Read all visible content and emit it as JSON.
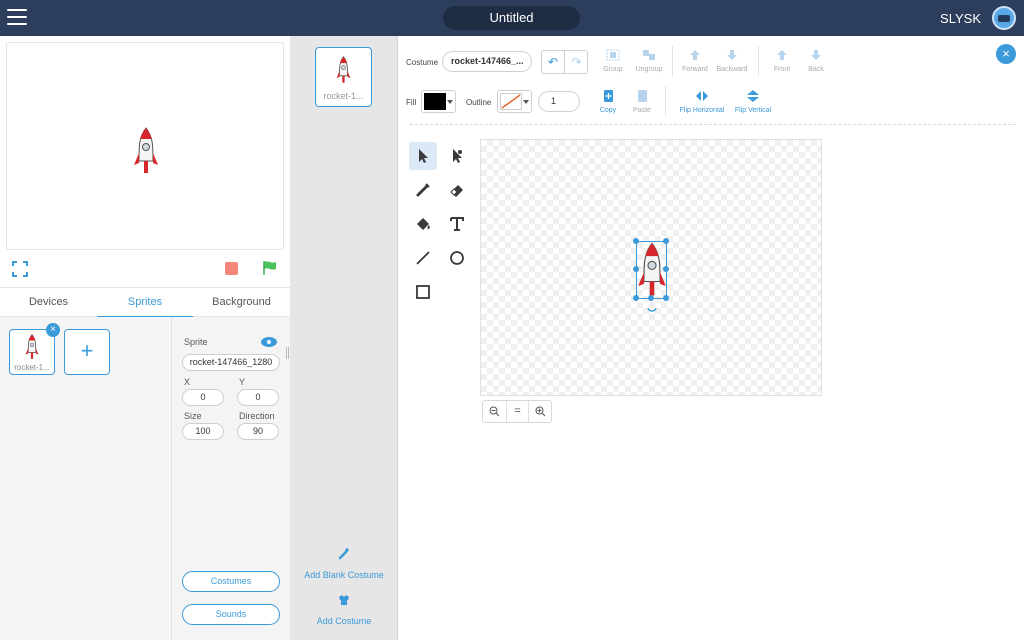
{
  "app": {
    "project_title": "Untitled",
    "user_name": "SLYSK",
    "icons": {
      "menu": "hamburger-menu-icon",
      "robot": "robot-icon"
    }
  },
  "stage": {
    "controls": {
      "fullscreen": "fullscreen-icon",
      "stop": "stop-icon",
      "go": "green-flag-icon"
    }
  },
  "tabs": [
    {
      "label": "Devices",
      "active": false
    },
    {
      "label": "Sprites",
      "active": true
    },
    {
      "label": "Background",
      "active": false
    }
  ],
  "sprites": {
    "items": [
      {
        "label": "rocket-1..."
      }
    ],
    "add_label": "+"
  },
  "sprite_props": {
    "sprite_label": "Sprite",
    "sprite_name": "rocket-147466_1280",
    "x_label": "X",
    "x_value": "0",
    "y_label": "Y",
    "y_value": "0",
    "size_label": "Size",
    "size_value": "100",
    "direction_label": "Direction",
    "direction_value": "90",
    "costumes_button": "Costumes",
    "sounds_button": "Sounds"
  },
  "costumes": {
    "items": [
      {
        "label": "rocket-1..."
      }
    ],
    "add_blank": "Add Blank Costume",
    "add_costume": "Add Costume"
  },
  "editor": {
    "costume_label": "Costume",
    "costume_name": "rocket-147466_...",
    "fill_label": "Fill",
    "fill_color": "#000000",
    "outline_label": "Outline",
    "outline_width": "1",
    "commands": {
      "group": "Group",
      "ungroup": "Ungroup",
      "forward": "Forward",
      "backward": "Backward",
      "front": "Front",
      "back": "Back",
      "copy": "Copy",
      "paste": "Paste",
      "flip_horizontal": "Flip Horizontal",
      "flip_vertical": "Flip Vertical"
    },
    "zoom": {
      "out": "zoom-out-icon",
      "reset": "=",
      "in": "zoom-in-icon"
    }
  },
  "colors": {
    "accent": "#3b9ad9",
    "topbar": "#2c3e5c",
    "stop": "#f4877a",
    "flag": "#4cc35a"
  }
}
